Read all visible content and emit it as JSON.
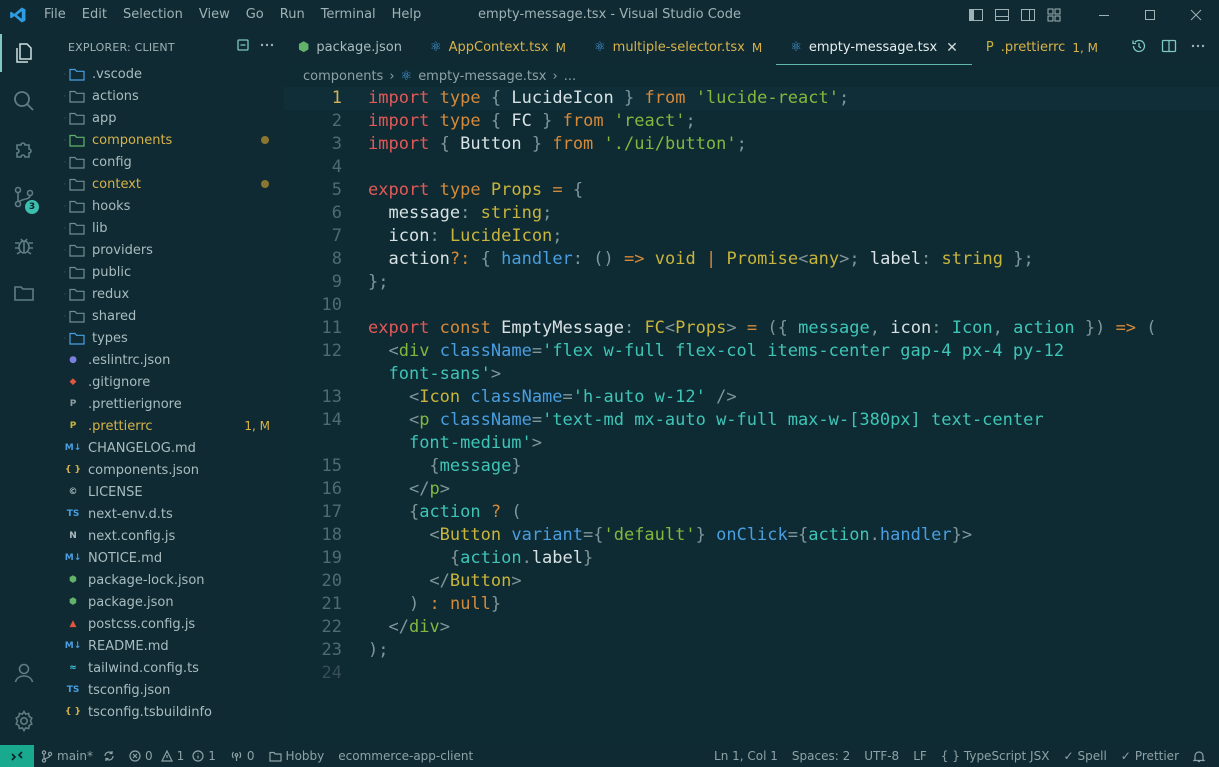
{
  "titlebar": {
    "menu": [
      "File",
      "Edit",
      "Selection",
      "View",
      "Go",
      "Run",
      "Terminal",
      "Help"
    ],
    "window_title": "empty-message.tsx - Visual Studio Code"
  },
  "activity_bar": {
    "source_control_badge": "3"
  },
  "sidebar": {
    "title": "EXPLORER: CLIENT",
    "items": [
      {
        "label": ".vscode",
        "type": "folder"
      },
      {
        "label": "actions",
        "type": "folder"
      },
      {
        "label": "app",
        "type": "folder"
      },
      {
        "label": "components",
        "type": "folder",
        "modified": true
      },
      {
        "label": "config",
        "type": "folder"
      },
      {
        "label": "context",
        "type": "folder",
        "modified": true
      },
      {
        "label": "hooks",
        "type": "folder"
      },
      {
        "label": "lib",
        "type": "folder"
      },
      {
        "label": "providers",
        "type": "folder"
      },
      {
        "label": "public",
        "type": "folder"
      },
      {
        "label": "redux",
        "type": "folder"
      },
      {
        "label": "shared",
        "type": "folder"
      },
      {
        "label": "types",
        "type": "folder"
      },
      {
        "label": ".eslintrc.json",
        "type": "file"
      },
      {
        "label": ".gitignore",
        "type": "file"
      },
      {
        "label": ".prettierignore",
        "type": "file"
      },
      {
        "label": ".prettierrc",
        "type": "file",
        "status": "1, M"
      },
      {
        "label": "CHANGELOG.md",
        "type": "file"
      },
      {
        "label": "components.json",
        "type": "file"
      },
      {
        "label": "LICENSE",
        "type": "file"
      },
      {
        "label": "next-env.d.ts",
        "type": "file"
      },
      {
        "label": "next.config.js",
        "type": "file"
      },
      {
        "label": "NOTICE.md",
        "type": "file"
      },
      {
        "label": "package-lock.json",
        "type": "file"
      },
      {
        "label": "package.json",
        "type": "file"
      },
      {
        "label": "postcss.config.js",
        "type": "file"
      },
      {
        "label": "README.md",
        "type": "file"
      },
      {
        "label": "tailwind.config.ts",
        "type": "file"
      },
      {
        "label": "tsconfig.json",
        "type": "file"
      },
      {
        "label": "tsconfig.tsbuildinfo",
        "type": "file"
      }
    ]
  },
  "tabs": [
    {
      "label": "package.json",
      "modified": false,
      "status": ""
    },
    {
      "label": "AppContext.tsx",
      "modified": true,
      "status": "M"
    },
    {
      "label": "multiple-selector.tsx",
      "modified": true,
      "status": "M"
    },
    {
      "label": "empty-message.tsx",
      "modified": false,
      "status": "",
      "active": true
    },
    {
      "label": ".prettierrc",
      "modified": true,
      "status": "1, M"
    }
  ],
  "breadcrumb": {
    "folder": "components",
    "file": "empty-message.tsx",
    "more": "..."
  },
  "editor": {
    "lines": [
      {
        "n": "1"
      },
      {
        "n": "2"
      },
      {
        "n": "3"
      },
      {
        "n": "4"
      },
      {
        "n": "5"
      },
      {
        "n": "6"
      },
      {
        "n": "7"
      },
      {
        "n": "8"
      },
      {
        "n": "9"
      },
      {
        "n": "10"
      },
      {
        "n": "11"
      },
      {
        "n": "12"
      },
      {
        "n": ""
      },
      {
        "n": "13"
      },
      {
        "n": "14"
      },
      {
        "n": ""
      },
      {
        "n": "15"
      },
      {
        "n": "16"
      },
      {
        "n": "17"
      },
      {
        "n": "18"
      },
      {
        "n": "19"
      },
      {
        "n": "20"
      },
      {
        "n": "21"
      },
      {
        "n": "22"
      },
      {
        "n": "23"
      },
      {
        "n": "24"
      }
    ]
  },
  "statusbar": {
    "branch": "main*",
    "errors": "0",
    "warnings": "1",
    "infos": "1",
    "ports": "0",
    "workspace": "Hobby",
    "project": "ecommerce-app-client",
    "position": "Ln 1, Col 1",
    "spaces": "Spaces: 2",
    "encoding": "UTF-8",
    "eol": "LF",
    "language": "TypeScript JSX",
    "spell": "Spell",
    "prettier": "Prettier"
  }
}
